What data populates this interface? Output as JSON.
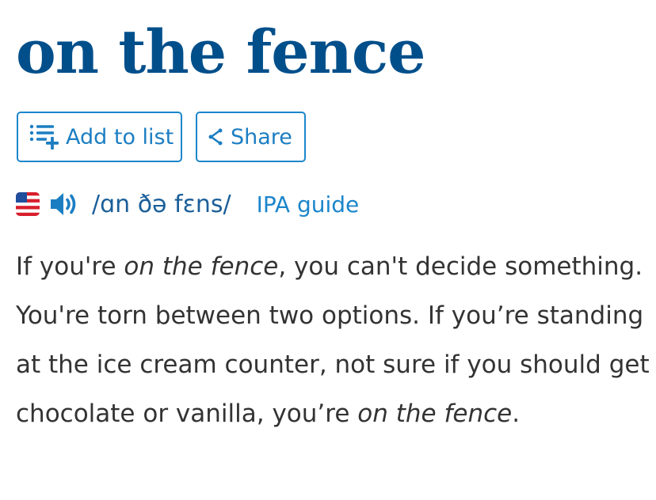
{
  "entry": {
    "title": "on the fence"
  },
  "actions": {
    "add_to_list": {
      "label": "Add to list",
      "icon": "add-to-list-icon"
    },
    "share": {
      "label": "Share",
      "icon": "share-icon"
    }
  },
  "pronunciation": {
    "region_icon": "us-flag-icon",
    "audio_icon": "speaker-icon",
    "ipa": "/ɑn ðə fɛns/",
    "ipa_guide_link": "IPA guide"
  },
  "definition": {
    "part1": "If you're ",
    "phrase1": "on the fence",
    "part2": ", you can't decide something. You're torn between two options. If you’re standing at the ice cream counter, not sure if you should get chocolate or vanilla, you’re ",
    "phrase2": "on the fence",
    "part3": "."
  },
  "colors": {
    "title": "#004f8b",
    "link": "#1c86cb",
    "ipa": "#1b5f99",
    "body_text": "#333333"
  }
}
